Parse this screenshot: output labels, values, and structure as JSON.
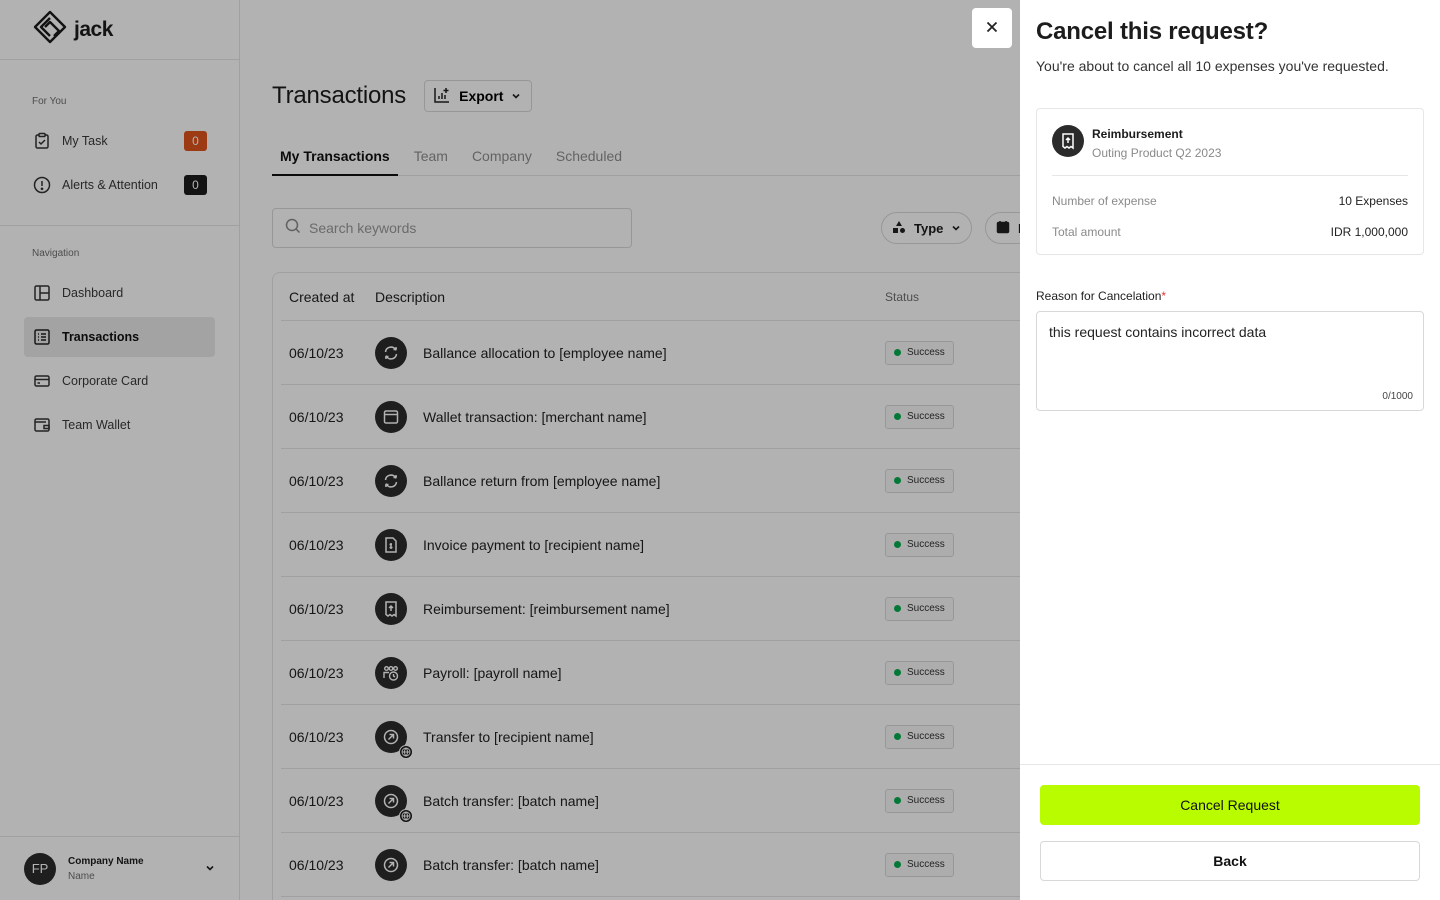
{
  "app": {
    "name": "jack"
  },
  "sidebar": {
    "for_you_label": "For You",
    "for_you_items": [
      {
        "label": "My Task",
        "count": "0",
        "count_color": "#e0531d",
        "icon": "clipboard-check-icon"
      },
      {
        "label": "Alerts & Attention",
        "count": "0",
        "count_color": "#1c1c1c",
        "icon": "alert-circle-icon"
      }
    ],
    "navigation_label": "Navigation",
    "nav_items": [
      {
        "label": "Dashboard",
        "icon": "layout-icon",
        "active": false
      },
      {
        "label": "Transactions",
        "icon": "list-icon",
        "active": true
      },
      {
        "label": "Corporate Card",
        "icon": "credit-card-icon",
        "active": false
      },
      {
        "label": "Team Wallet",
        "icon": "wallet-icon",
        "active": false
      }
    ],
    "footer": {
      "initials": "FP",
      "company": "Company Name",
      "name": "Name"
    }
  },
  "main": {
    "title": "Transactions",
    "export_label": "Export",
    "tabs": [
      "My Transactions",
      "Team",
      "Company",
      "Scheduled"
    ],
    "search_placeholder": "Search keywords",
    "filters": {
      "type_label": "Type",
      "date_label": "D"
    },
    "table": {
      "headers": {
        "created_at": "Created at",
        "description": "Description",
        "status": "Status"
      },
      "rows": [
        {
          "date": "06/10/23",
          "description": "Ballance allocation to [employee name]",
          "status": "Success",
          "icon": "refresh-icon"
        },
        {
          "date": "06/10/23",
          "description": "Wallet transaction: [merchant name]",
          "status": "Success",
          "icon": "wallet-icon"
        },
        {
          "date": "06/10/23",
          "description": "Ballance return from [employee name]",
          "status": "Success",
          "icon": "refresh-icon"
        },
        {
          "date": "06/10/23",
          "description": "Invoice payment to [recipient name]",
          "status": "Success",
          "icon": "invoice-icon"
        },
        {
          "date": "06/10/23",
          "description": "Reimbursement: [reimbursement name]",
          "status": "Success",
          "icon": "receipt-icon"
        },
        {
          "date": "06/10/23",
          "description": "Payroll: [payroll name]",
          "status": "Success",
          "icon": "payroll-icon"
        },
        {
          "date": "06/10/23",
          "description": "Transfer to [recipient name]",
          "status": "Success",
          "icon": "transfer-icon",
          "international": true
        },
        {
          "date": "06/10/23",
          "description": "Batch transfer: [batch name]",
          "status": "Success",
          "icon": "transfer-icon",
          "international": true
        },
        {
          "date": "06/10/23",
          "description": "Batch transfer: [batch name]",
          "status": "Success",
          "icon": "transfer-icon",
          "international": false
        }
      ]
    }
  },
  "drawer": {
    "title": "Cancel this request?",
    "subtitle": "You're about to cancel all 10 expenses you've requested.",
    "card": {
      "type": "Reimbursement",
      "name": "Outing Product Q2 2023",
      "expense_label": "Number of expense",
      "expense_value": "10 Expenses",
      "amount_label": "Total amount",
      "amount_value": "IDR 1,000,000"
    },
    "reason_label": "Reason for Cancelation",
    "reason_required": "*",
    "reason_value": "this request contains incorrect data",
    "reason_counter": "0/1000",
    "primary_button": "Cancel Request",
    "secondary_button": "Back"
  },
  "colors": {
    "accent": "#b9fc00",
    "success": "#06ac4e",
    "badge_orange": "#e0531d"
  }
}
